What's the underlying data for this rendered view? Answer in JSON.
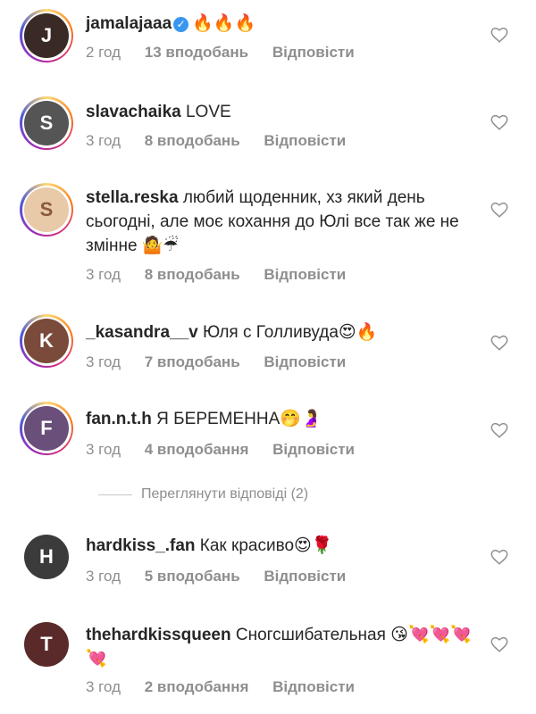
{
  "comments": [
    {
      "user": "jamalajaaa",
      "text": "🔥🔥🔥",
      "time": "2 год",
      "likes": "13 вподобань",
      "reply": "Відповісти",
      "verified": true,
      "avatar_color": "#3a2a26"
    },
    {
      "user": "slavachaika",
      "text": "LOVE",
      "time": "3 год",
      "likes": "8 вподобань",
      "reply": "Відповісти",
      "avatar_color": "#555555"
    },
    {
      "user": "stella.reska",
      "text": "любий щоденник, хз який день сьогодні, але моє кохання до Юлі все так же не змінне 🤷☔",
      "time": "3 год",
      "likes": "8 вподобань",
      "reply": "Відповісти",
      "avatar_color": "#e8c9a8"
    },
    {
      "user": "_kasandra__v",
      "text": "Юля с Голливуда😍🔥",
      "time": "3 год",
      "likes": "7 вподобань",
      "reply": "Відповісти",
      "avatar_color": "#7a4a3a"
    },
    {
      "user": "fan.n.t.h",
      "text": "Я БЕРЕМЕННА🤭🤰",
      "time": "3 год",
      "likes": "4 вподобання",
      "reply": "Відповісти",
      "avatar_color": "#6a4f7a"
    },
    {
      "user": "hardkiss_.fan",
      "text": "Как красиво😍🌹",
      "time": "3 год",
      "likes": "5 вподобань",
      "reply": "Відповісти",
      "avatar_color": "#3b3b3b"
    },
    {
      "user": "thehardkissqueen",
      "text": "Сногсшибательная 😘💘💘💘💘",
      "time": "3 год",
      "likes": "2 вподобання",
      "reply": "Відповісти",
      "avatar_color": "#5a2a2a"
    }
  ],
  "view_replies": "Переглянути відповіді (2)"
}
